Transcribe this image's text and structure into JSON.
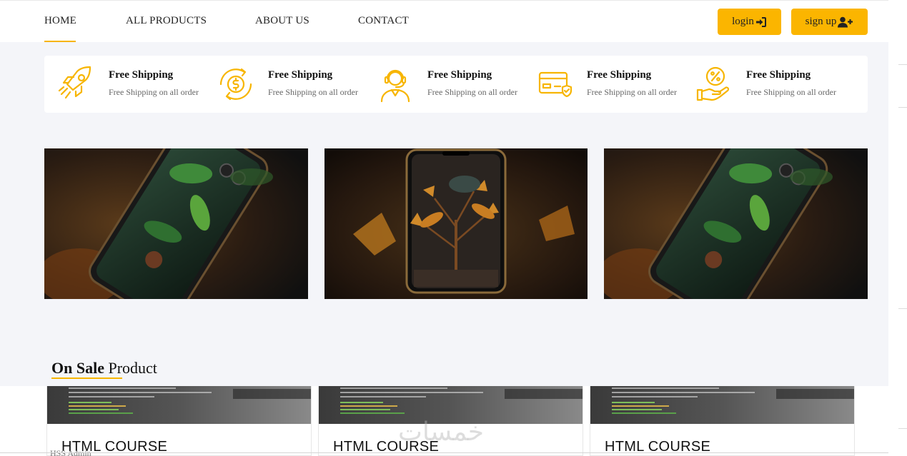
{
  "nav": {
    "links": [
      "HOME",
      "ALL PRODUCTS",
      "ABOUT US",
      "CONTACT"
    ],
    "login_label": "login",
    "signup_label": "sign up"
  },
  "features": [
    {
      "icon": "rocket-icon",
      "title": "Free Shipping",
      "desc": "Free Shipping on all order"
    },
    {
      "icon": "money-exchange-icon",
      "title": "Free Shipping",
      "desc": "Free Shipping on all order"
    },
    {
      "icon": "support-agent-icon",
      "title": "Free Shipping",
      "desc": "Free Shipping on all order"
    },
    {
      "icon": "credit-card-shield-icon",
      "title": "Free Shipping",
      "desc": "Free Shipping on all order"
    },
    {
      "icon": "discount-hand-icon",
      "title": "Free Shipping",
      "desc": "Free Shipping on all order"
    }
  ],
  "banners": [
    "phone-with-green-leaves-image",
    "phone-with-autumn-plant-image",
    "phone-with-green-leaves-image"
  ],
  "section": {
    "title_bold": "On Sale",
    "title_rest": "Product"
  },
  "cards": [
    {
      "title": "HTML COURSE"
    },
    {
      "title": "HTML COURSE"
    },
    {
      "title": "HTML COURSE"
    }
  ],
  "watermark": "خمسات",
  "footer_partial_text": "HSS Admin",
  "colors": {
    "accent": "#fbb500",
    "page_bg": "#f4f5f9",
    "card_bg": "#ffffff",
    "text": "#222222"
  }
}
